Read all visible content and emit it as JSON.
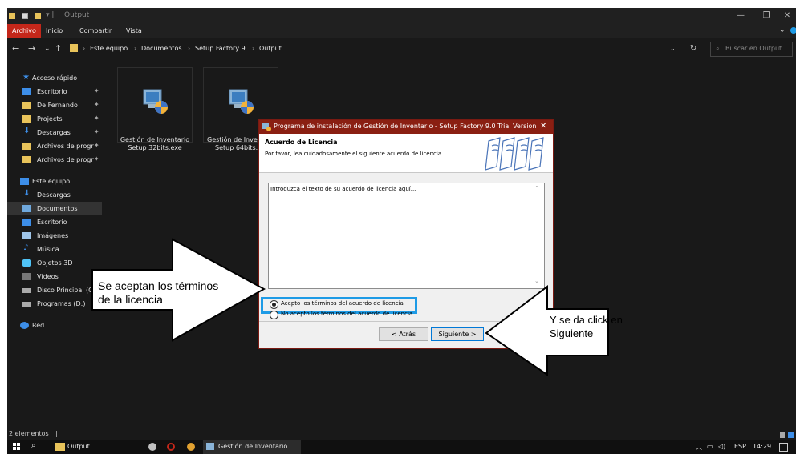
{
  "window": {
    "title": "Output",
    "controls": [
      "minimize-icon",
      "maximize-icon",
      "close-icon"
    ]
  },
  "ribbon": {
    "tabs": [
      "Archivo",
      "Inicio",
      "Compartir",
      "Vista"
    ],
    "active": "Archivo"
  },
  "address": {
    "breadcrumbs": [
      "Este equipo",
      "Documentos",
      "Setup Factory 9",
      "Output"
    ],
    "search_placeholder": "Buscar en Output"
  },
  "sidebar": {
    "quick_access": "Acceso rápido",
    "quick_items": [
      "Escritorio",
      "De Fernando",
      "Projects",
      "Descargas",
      "Archivos de progr",
      "Archivos de progr"
    ],
    "this_pc": "Este equipo",
    "pc_items": [
      "Descargas",
      "Documentos",
      "Escritorio",
      "Imágenes",
      "Música",
      "Objetos 3D",
      "Vídeos",
      "Disco Principal (C",
      "Programas (D:)"
    ],
    "selected": "Documentos",
    "network": "Red"
  },
  "files": [
    {
      "line1": "Gestión de Inventario",
      "line2": "Setup 32bits.exe"
    },
    {
      "line1": "Gestión de Inven",
      "line2": "Setup 64bits.e"
    }
  ],
  "dialog": {
    "title": "Programa de instalación de Gestión de Inventario - Setup Factory 9.0 Trial Version",
    "heading": "Acuerdo de Licencia",
    "subheading": "Por favor, lea cuidadosamente el siguiente acuerdo de licencia.",
    "license_text": "Introduzca el texto de su acuerdo de licencia aquí...",
    "accept_option": "Acepto los términos del acuerdo de licencia",
    "reject_option": "No acepto los términos del acuerdo de licencia",
    "accept_selected": true,
    "back_button": "< Atrás",
    "next_button": "Siguiente >"
  },
  "annotations": {
    "left_callout_line1": "Se aceptan los términos",
    "left_callout_line2": "de la licencia",
    "right_callout_line1": "Y se da click en",
    "right_callout_line2": "Siguiente"
  },
  "status_bar": {
    "count": "2 elementos"
  },
  "taskbar": {
    "items": [
      "Output",
      "Gestión de Inventario ..."
    ],
    "language": "ESP",
    "time": "14:29"
  },
  "colors": {
    "accent_red": "#c4271a",
    "highlight_blue": "#1e9be6",
    "dialog_title": "#8a1f12"
  }
}
